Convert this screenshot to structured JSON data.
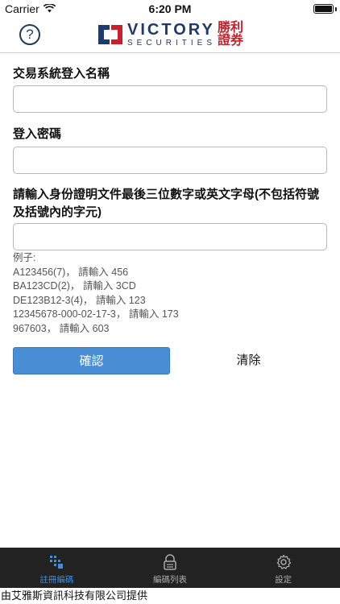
{
  "status": {
    "carrier": "Carrier",
    "time": "6:20 PM"
  },
  "brand": {
    "name": "VICTORY",
    "sub": "SECURITIES",
    "cn_top": "勝利",
    "cn_bottom": "證券",
    "color_primary": "#1f3a6c",
    "color_accent": "#c8202c"
  },
  "help_icon": "?",
  "form": {
    "username_label": "交易系統登入名稱",
    "username_value": "",
    "password_label": "登入密碼",
    "password_value": "",
    "id_label": "請輸入身份證明文件最後三位數字或英文字母(不包括符號及括號內的字元)",
    "id_value": "",
    "example_title": "例子:",
    "examples": [
      "A123456(7)， 請輸入 456",
      "BA123CD(2)， 請輸入 3CD",
      "DE123B12-3(4)， 請輸入 123",
      "12345678-000-02-17-3， 請輸入 173",
      "967603， 請輸入 603"
    ]
  },
  "buttons": {
    "confirm": "確認",
    "clear": "清除",
    "confirm_color": "#4a8fd6"
  },
  "tabs": [
    {
      "label": "註冊編碼",
      "icon": "grid-key-icon",
      "active": true
    },
    {
      "label": "編碼列表",
      "icon": "lock-icon",
      "active": false
    },
    {
      "label": "設定",
      "icon": "gear-icon",
      "active": false
    }
  ],
  "footer": "由艾雅斯資訊科技有限公司提供"
}
